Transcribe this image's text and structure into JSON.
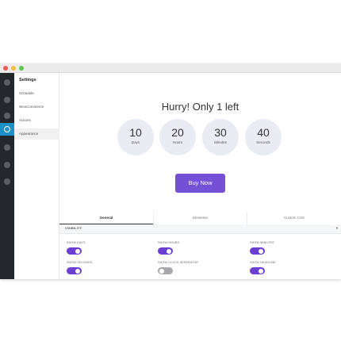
{
  "sidebar": {
    "title": "Settings",
    "items": [
      {
        "label": "Schedule"
      },
      {
        "label": "WooCommerce"
      },
      {
        "label": "Actions"
      },
      {
        "label": "Appearance",
        "active": true
      }
    ]
  },
  "preview": {
    "headline": "Hurry! Only 1 left",
    "timer": [
      {
        "value": "10",
        "unit": "Days"
      },
      {
        "value": "20",
        "unit": "Hours"
      },
      {
        "value": "30",
        "unit": "Minutes"
      },
      {
        "value": "40",
        "unit": "Seconds"
      }
    ],
    "button_label": "Buy Now"
  },
  "tabs": [
    {
      "label": "General",
      "active": true
    },
    {
      "label": "Elements"
    },
    {
      "label": "Custom CSS"
    }
  ],
  "section": {
    "label": "VISIBILITY",
    "caret": "▾"
  },
  "toggles": [
    {
      "label": "SHOW DAYS",
      "on": true
    },
    {
      "label": "SHOW HOURS",
      "on": true
    },
    {
      "label": "SHOW MINUTES",
      "on": true
    },
    {
      "label": "SHOW SECONDS",
      "on": true
    },
    {
      "label": "SHOW CLOCK SEPARATOR",
      "on": false
    },
    {
      "label": "SHOW HEADLINE",
      "on": true
    }
  ],
  "colors": {
    "accent": "#7450d6",
    "toggle_on": "#6b3fd1",
    "toggle_off": "#a9a9ad",
    "admin_bar": "#23282d",
    "active_icon_bg": "#1f8fc7"
  },
  "icons": [
    "dashboard-icon",
    "posts-icon",
    "countdown-icon",
    "media-icon",
    "pages-icon",
    "comments-icon"
  ]
}
